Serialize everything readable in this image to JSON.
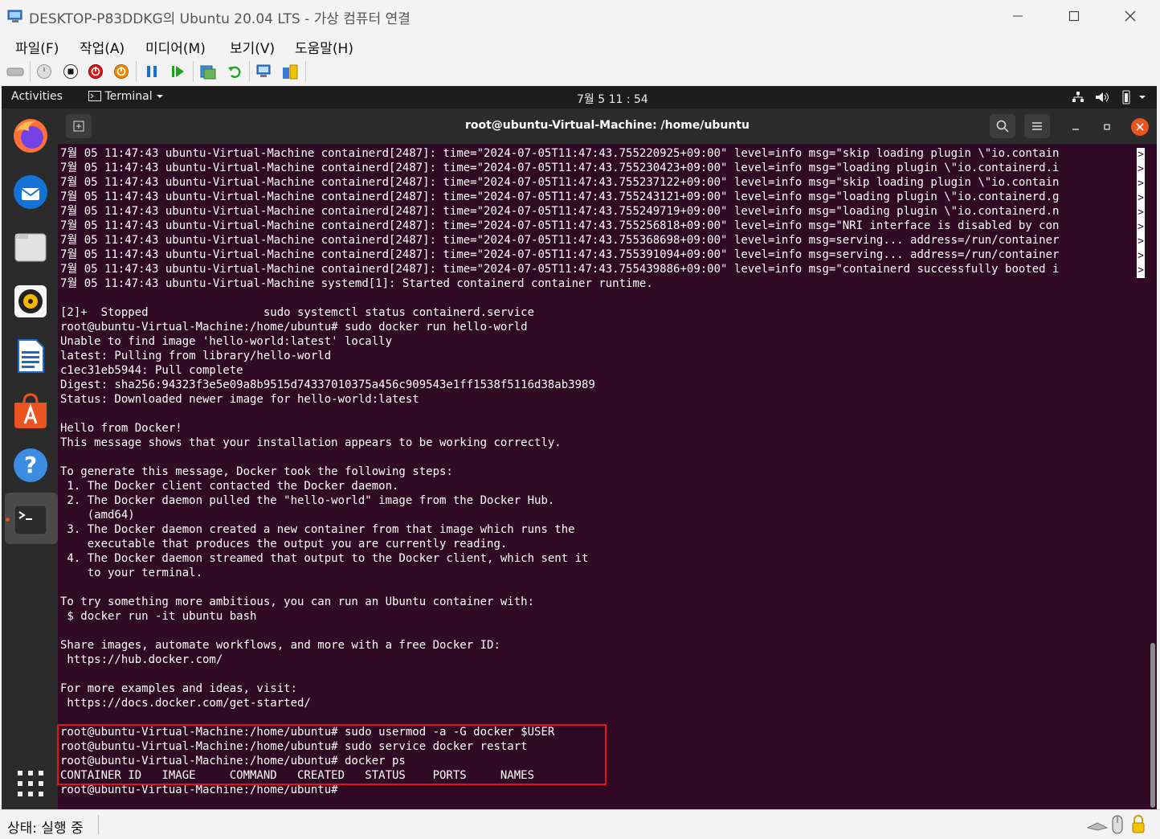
{
  "window": {
    "title": "DESKTOP-P83DDKG의 Ubuntu 20.04 LTS - 가상 컴퓨터 연결",
    "controls": [
      "minimize-icon",
      "maximize-icon",
      "close-icon"
    ]
  },
  "menu": {
    "items": [
      "파일(F)",
      "작업(A)",
      "미디어(M)",
      "보기(V)",
      "도움말(H)"
    ]
  },
  "toolbar": {
    "icons": [
      "ctrl-alt-del-icon",
      "start-icon",
      "turn-off-icon",
      "shutdown-icon",
      "power-save-icon",
      "pause-icon",
      "resume-icon",
      "checkpoint-icon",
      "revert-icon",
      "enhanced-session-icon",
      "share-icon"
    ]
  },
  "gnome_bar": {
    "activities": "Activities",
    "app_menu": "Terminal",
    "clock": "7월 5  11 : 54"
  },
  "dock": {
    "apps": [
      "firefox-icon",
      "thunderbird-icon",
      "files-icon",
      "rhythmbox-icon",
      "writer-icon",
      "software-icon",
      "help-icon",
      "terminal-icon",
      "show-apps-icon"
    ]
  },
  "terminal": {
    "title": "root@ubuntu-Virtual-Machine: /home/ubuntu",
    "log_lines": [
      "7월 05 11:47:43 ubuntu-Virtual-Machine containerd[2487]: time=\"2024-07-05T11:47:43.755220925+09:00\" level=info msg=\"skip loading plugin \\\"io.contain",
      "7월 05 11:47:43 ubuntu-Virtual-Machine containerd[2487]: time=\"2024-07-05T11:47:43.755230423+09:00\" level=info msg=\"loading plugin \\\"io.containerd.i",
      "7월 05 11:47:43 ubuntu-Virtual-Machine containerd[2487]: time=\"2024-07-05T11:47:43.755237122+09:00\" level=info msg=\"skip loading plugin \\\"io.contain",
      "7월 05 11:47:43 ubuntu-Virtual-Machine containerd[2487]: time=\"2024-07-05T11:47:43.755243121+09:00\" level=info msg=\"loading plugin \\\"io.containerd.g",
      "7월 05 11:47:43 ubuntu-Virtual-Machine containerd[2487]: time=\"2024-07-05T11:47:43.755249719+09:00\" level=info msg=\"loading plugin \\\"io.containerd.n",
      "7월 05 11:47:43 ubuntu-Virtual-Machine containerd[2487]: time=\"2024-07-05T11:47:43.755256818+09:00\" level=info msg=\"NRI interface is disabled by con",
      "7월 05 11:47:43 ubuntu-Virtual-Machine containerd[2487]: time=\"2024-07-05T11:47:43.755368698+09:00\" level=info msg=serving... address=/run/container",
      "7월 05 11:47:43 ubuntu-Virtual-Machine containerd[2487]: time=\"2024-07-05T11:47:43.755391094+09:00\" level=info msg=serving... address=/run/container",
      "7월 05 11:47:43 ubuntu-Virtual-Machine containerd[2487]: time=\"2024-07-05T11:47:43.755439886+09:00\" level=info msg=\"containerd successfully booted i",
      "7월 05 11:47:43 ubuntu-Virtual-Machine systemd[1]: Started containerd container runtime."
    ],
    "output_lines": [
      "",
      "[2]+  Stopped                 sudo systemctl status containerd.service",
      "root@ubuntu-Virtual-Machine:/home/ubuntu# sudo docker run hello-world",
      "Unable to find image 'hello-world:latest' locally",
      "latest: Pulling from library/hello-world",
      "c1ec31eb5944: Pull complete",
      "Digest: sha256:94323f3e5e09a8b9515d74337010375a456c909543e1ff1538f5116d38ab3989",
      "Status: Downloaded newer image for hello-world:latest",
      "",
      "Hello from Docker!",
      "This message shows that your installation appears to be working correctly.",
      "",
      "To generate this message, Docker took the following steps:",
      " 1. The Docker client contacted the Docker daemon.",
      " 2. The Docker daemon pulled the \"hello-world\" image from the Docker Hub.",
      "    (amd64)",
      " 3. The Docker daemon created a new container from that image which runs the",
      "    executable that produces the output you are currently reading.",
      " 4. The Docker daemon streamed that output to the Docker client, which sent it",
      "    to your terminal.",
      "",
      "To try something more ambitious, you can run an Ubuntu container with:",
      " $ docker run -it ubuntu bash",
      "",
      "Share images, automate workflows, and more with a free Docker ID:",
      " https://hub.docker.com/",
      "",
      "For more examples and ideas, visit:",
      " https://docs.docker.com/get-started/",
      "",
      "root@ubuntu-Virtual-Machine:/home/ubuntu# sudo usermod -a -G docker $USER",
      "root@ubuntu-Virtual-Machine:/home/ubuntu# sudo service docker restart",
      "root@ubuntu-Virtual-Machine:/home/ubuntu# docker ps",
      "CONTAINER ID   IMAGE     COMMAND   CREATED   STATUS    PORTS     NAMES",
      "root@ubuntu-Virtual-Machine:/home/ubuntu# "
    ],
    "overflow_marker": ">"
  },
  "status": {
    "text": "상태: 실행 중"
  },
  "colors": {
    "terminal_bg": "#300a24",
    "highlight_border": "#e8101a",
    "ubuntu_orange": "#e95420"
  }
}
